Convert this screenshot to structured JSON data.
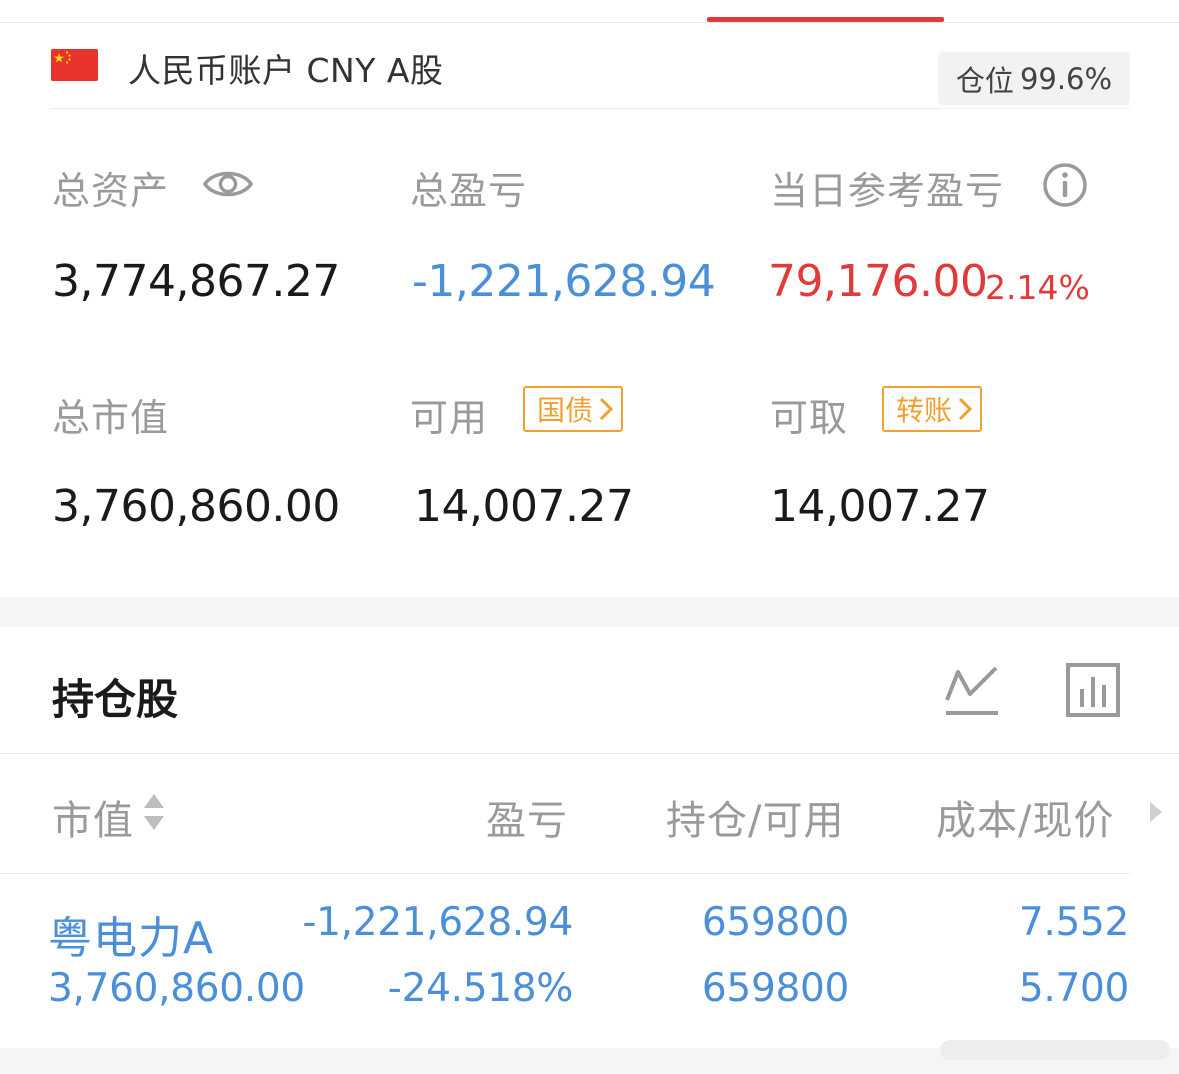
{
  "account": {
    "title": "人民币账户 CNY A股",
    "position_label": "仓位",
    "position_value": "99.6%"
  },
  "stats": {
    "total_assets_label": "总资产",
    "total_assets_value": "3,774,867.27",
    "total_pnl_label": "总盈亏",
    "total_pnl_value": "-1,221,628.94",
    "daily_pnl_label": "当日参考盈亏",
    "daily_pnl_value": "79,176.00",
    "daily_pnl_percent": "2.14%",
    "market_value_label": "总市值",
    "market_value_value": "3,760,860.00",
    "available_label": "可用",
    "available_value": "14,007.27",
    "available_pill": "国债",
    "withdrawable_label": "可取",
    "withdrawable_value": "14,007.27",
    "withdrawable_pill": "转账"
  },
  "holdings": {
    "section_title": "持仓股",
    "columns": [
      "市值",
      "盈亏",
      "持仓/可用",
      "成本/现价"
    ],
    "rows": [
      {
        "name": "粤电力A",
        "market_value": "3,760,860.00",
        "pnl": "-1,221,628.94",
        "pnl_percent": "-24.518%",
        "position": "659800",
        "available": "659800",
        "cost": "7.552",
        "price": "5.700"
      }
    ]
  },
  "colors": {
    "accent_red": "#e03a3a",
    "accent_blue": "#4a8fd8",
    "pill_orange": "#f0a030"
  },
  "icons": {
    "flag": "china-flag-icon",
    "eye": "eye-icon",
    "info": "info-icon",
    "trend": "line-chart-icon",
    "bars": "bar-chart-icon",
    "sort": "sort-icon",
    "more": "triangle-right-icon"
  }
}
